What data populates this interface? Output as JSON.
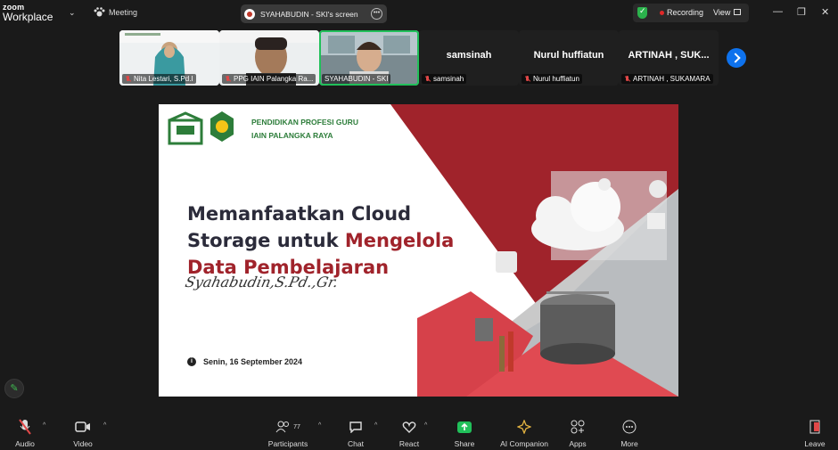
{
  "app": {
    "brand_top": "zoom",
    "brand_bottom": "Workplace"
  },
  "header": {
    "meeting_label": "Meeting",
    "share_label": "SYAHABUDIN - SKI's screen",
    "recording_label": "Recording",
    "view_label": "View"
  },
  "participants": {
    "video_tiles": [
      {
        "name": "Nita Lestari, S.Pd.I"
      },
      {
        "name": "PPG IAIN Palangka Ra..."
      },
      {
        "name": "SYAHABUDIN - SKI"
      }
    ],
    "name_tiles": [
      {
        "title": "samsinah",
        "name": "samsinah"
      },
      {
        "title": "Nurul huffiatun",
        "name": "Nurul huffiatun"
      },
      {
        "title": "ARTINAH , SUK...",
        "name": "ARTINAH , SUKAMARA"
      }
    ]
  },
  "slide": {
    "org_line1": "PENDIDIKAN PROFESI GURU",
    "org_line2": "IAIN PALANGKA RAYA",
    "title_part1": "Memanfaatkan Cloud",
    "title_part2": "Storage untuk ",
    "title_red1": "Mengelola",
    "title_red2": "Data Pembelajaran",
    "signature": "Syahabudin,S.Pd.,Gr.",
    "date": "Senin, 16 September 2024"
  },
  "toolbar": {
    "audio": "Audio",
    "video": "Video",
    "participants": "Participants",
    "participants_count": "77",
    "chat": "Chat",
    "react": "React",
    "share": "Share",
    "ai": "AI Companion",
    "apps": "Apps",
    "more": "More",
    "leave": "Leave"
  },
  "colors": {
    "accent_red": "#a0232b",
    "share_green": "#21c05a",
    "brand_green": "#2d7d3a",
    "nav_blue": "#0e72ed"
  }
}
